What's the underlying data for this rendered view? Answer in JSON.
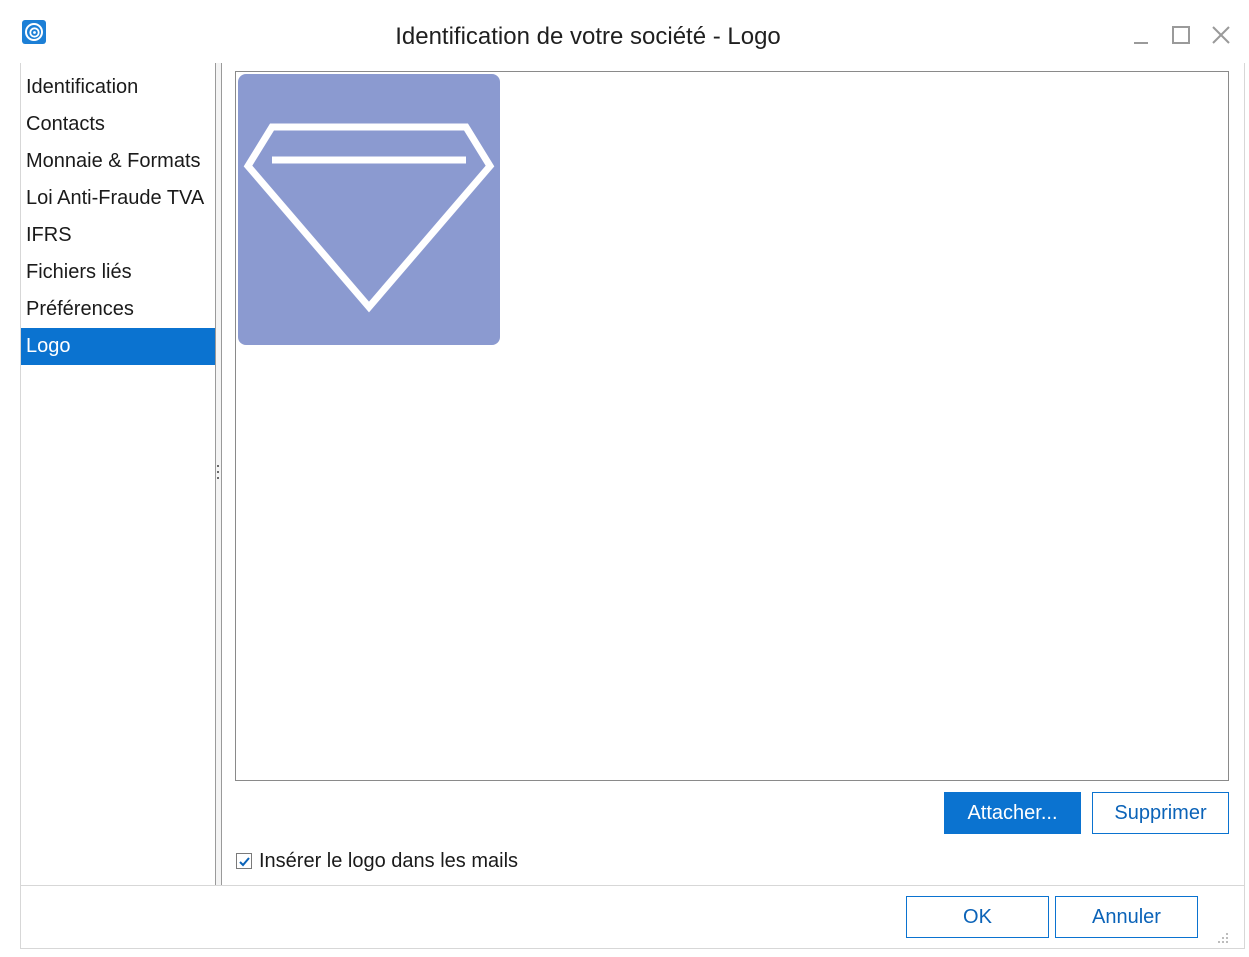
{
  "window": {
    "title": "Identification de votre société - Logo",
    "controls": [
      "minimize-icon",
      "maximize-icon",
      "close-icon"
    ]
  },
  "sidebar": {
    "items": [
      {
        "label": "Identification",
        "active": false
      },
      {
        "label": "Contacts",
        "active": false
      },
      {
        "label": "Monnaie & Formats",
        "active": false
      },
      {
        "label": "Loi Anti-Fraude TVA",
        "active": false
      },
      {
        "label": "IFRS",
        "active": false
      },
      {
        "label": "Fichiers liés",
        "active": false
      },
      {
        "label": "Préférences",
        "active": false
      },
      {
        "label": "Logo",
        "active": true
      }
    ]
  },
  "logo_panel": {
    "image_icon": "diamond-logo-icon",
    "attach_label": "Attacher...",
    "delete_label": "Supprimer"
  },
  "options": {
    "insert_logo_label": "Insérer le logo dans les mails",
    "insert_logo_checked": true
  },
  "footer": {
    "ok_label": "OK",
    "cancel_label": "Annuler"
  },
  "colors": {
    "accent": "#0b73d0",
    "logo_background": "#8b9ad0",
    "logo_stroke": "#ffffff"
  }
}
